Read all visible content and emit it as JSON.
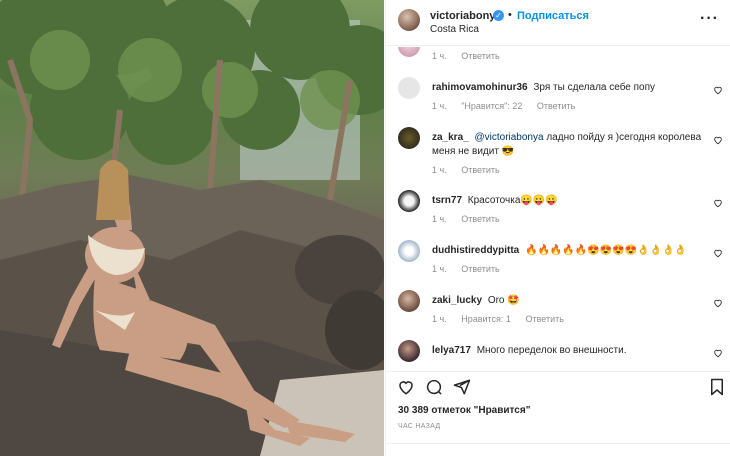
{
  "post": {
    "username": "victoriabonya",
    "verified_icon": "verified-badge-icon",
    "separator": "•",
    "follow_label": "Подписаться",
    "location": "Costa Rica",
    "more_icon": "more-options-icon"
  },
  "comments": {
    "first_meta": {
      "time": "1 ч.",
      "reply": "Ответить"
    },
    "items": [
      {
        "username": "rahimovamohinur36",
        "text": "Зря ты сделала себе попу",
        "time": "1 ч.",
        "likes": "\"Нравится\": 22",
        "reply": "Ответить"
      },
      {
        "username": "za_kra_",
        "mention": "@victoriabonya",
        "text": "ладно пойду я )сегодня королева меня не видит 😎",
        "time": "1 ч.",
        "likes": "",
        "reply": "Ответить"
      },
      {
        "username": "tsrn77",
        "text": "Красоточка😛😛😛",
        "time": "1 ч.",
        "likes": "",
        "reply": "Ответить"
      },
      {
        "username": "dudhistireddypitta",
        "text": "🔥🔥🔥🔥🔥😍😍😍😍👌👌👌👌",
        "time": "1 ч.",
        "likes": "",
        "reply": "Ответить"
      },
      {
        "username": "zaki_lucky",
        "text": "Oro 🤩",
        "time": "1 ч.",
        "likes": "Нравится: 1",
        "reply": "Ответить"
      },
      {
        "username": "lelya717",
        "text": "Много переделок во внешности.",
        "time": "",
        "likes": "",
        "reply": ""
      }
    ]
  },
  "footer": {
    "likes": "30 389 отметок \"Нравится\"",
    "time": "ЧАС НАЗАД"
  },
  "colors": {
    "accent": "#0095f6",
    "verified": "#3897f0",
    "muted": "#8e8e8e"
  }
}
